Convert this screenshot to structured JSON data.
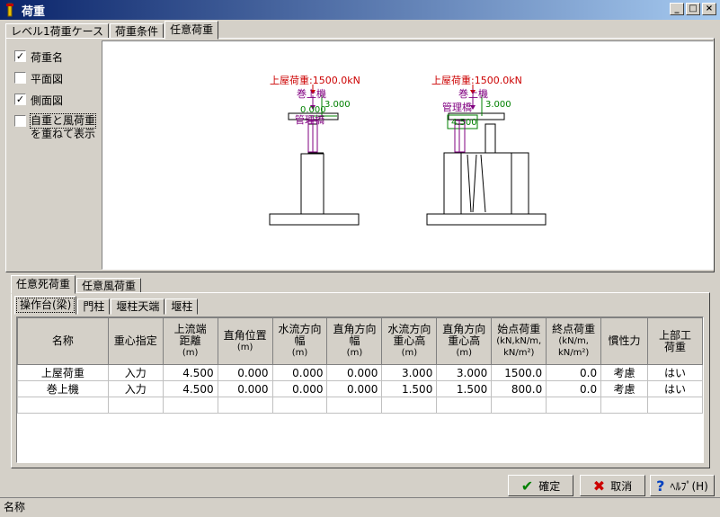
{
  "window": {
    "title": "荷重"
  },
  "top_tabs": [
    "レベル1荷重ケース",
    "荷重条件",
    "任意荷重"
  ],
  "options": {
    "load_name": {
      "label": "荷重名",
      "checked": true
    },
    "plan_view": {
      "label": "平面図",
      "checked": false
    },
    "side_view": {
      "label": "側面図",
      "checked": true
    },
    "overlay": {
      "label_line1": "自重と風荷重",
      "label_line2": "を重ねて表示",
      "checked": false
    }
  },
  "drawing": {
    "left": {
      "roof": "上屋荷重:1500.0kN",
      "hoist": "巻上機",
      "offset": "3.000",
      "zero": "0.000",
      "bridge": "管理橋"
    },
    "right": {
      "roof": "上屋荷重:1500.0kN",
      "hoist": "巻上機",
      "offset": "3.000",
      "bridge": "管理橋",
      "width": "4.500"
    },
    "colors": {
      "roof": "#cc0000",
      "hoist": "#800080",
      "dim": "#008000"
    }
  },
  "lower_tabs": [
    "任意死荷重",
    "任意風荷重"
  ],
  "sub_tabs": [
    "操作台(梁)",
    "門柱",
    "堰柱天端",
    "堰柱"
  ],
  "table": {
    "headers": [
      {
        "l1": "名称"
      },
      {
        "l1": "重心指定"
      },
      {
        "l1": "上流端",
        "l2": "距離",
        "l3": "(m)"
      },
      {
        "l1": "直角位置",
        "l2": "(m)"
      },
      {
        "l1": "水流方向",
        "l2": "幅",
        "l3": "(m)"
      },
      {
        "l1": "直角方向",
        "l2": "幅",
        "l3": "(m)"
      },
      {
        "l1": "水流方向",
        "l2": "重心高",
        "l3": "(m)"
      },
      {
        "l1": "直角方向",
        "l2": "重心高",
        "l3": "(m)"
      },
      {
        "l1": "始点荷重",
        "l2": "(kN,kN/m,",
        "l3": "kN/m²)"
      },
      {
        "l1": "終点荷重",
        "l2": "(kN/m,",
        "l3": "kN/m²)"
      },
      {
        "l1": "慣性力"
      },
      {
        "l1": "上部工",
        "l2": "荷重"
      }
    ],
    "rows": [
      [
        "上屋荷重",
        "入力",
        "4.500",
        "0.000",
        "0.000",
        "0.000",
        "3.000",
        "3.000",
        "1500.0",
        "0.0",
        "考慮",
        "はい"
      ],
      [
        "巻上機",
        "入力",
        "4.500",
        "0.000",
        "0.000",
        "0.000",
        "1.500",
        "1.500",
        "800.0",
        "0.0",
        "考慮",
        "はい"
      ]
    ]
  },
  "buttons": {
    "ok": "確定",
    "cancel": "取消",
    "help": "ﾍﾙﾌﾟ(H)"
  },
  "status": {
    "text": "名称"
  }
}
